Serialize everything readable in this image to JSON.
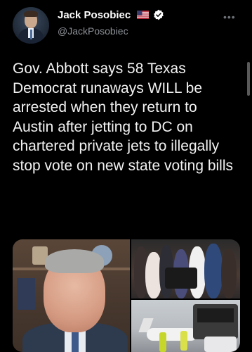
{
  "tweet": {
    "author_name": "Jack Posobiec",
    "author_handle": "@JackPosobiec",
    "flag_icon": "us-flag-icon",
    "verified_icon": "verified-badge-icon",
    "more_icon": "more-options-icon",
    "text": "Gov. Abbott says 58 Texas Democrat runaways WILL be arrested when they return to Austin after jetting to DC on chartered private jets to illegally stop vote on new state voting bills"
  },
  "colors": {
    "background": "#000000",
    "text": "#f2f2f2",
    "secondary_text": "#8b8f95",
    "verified": "#ffffff"
  }
}
